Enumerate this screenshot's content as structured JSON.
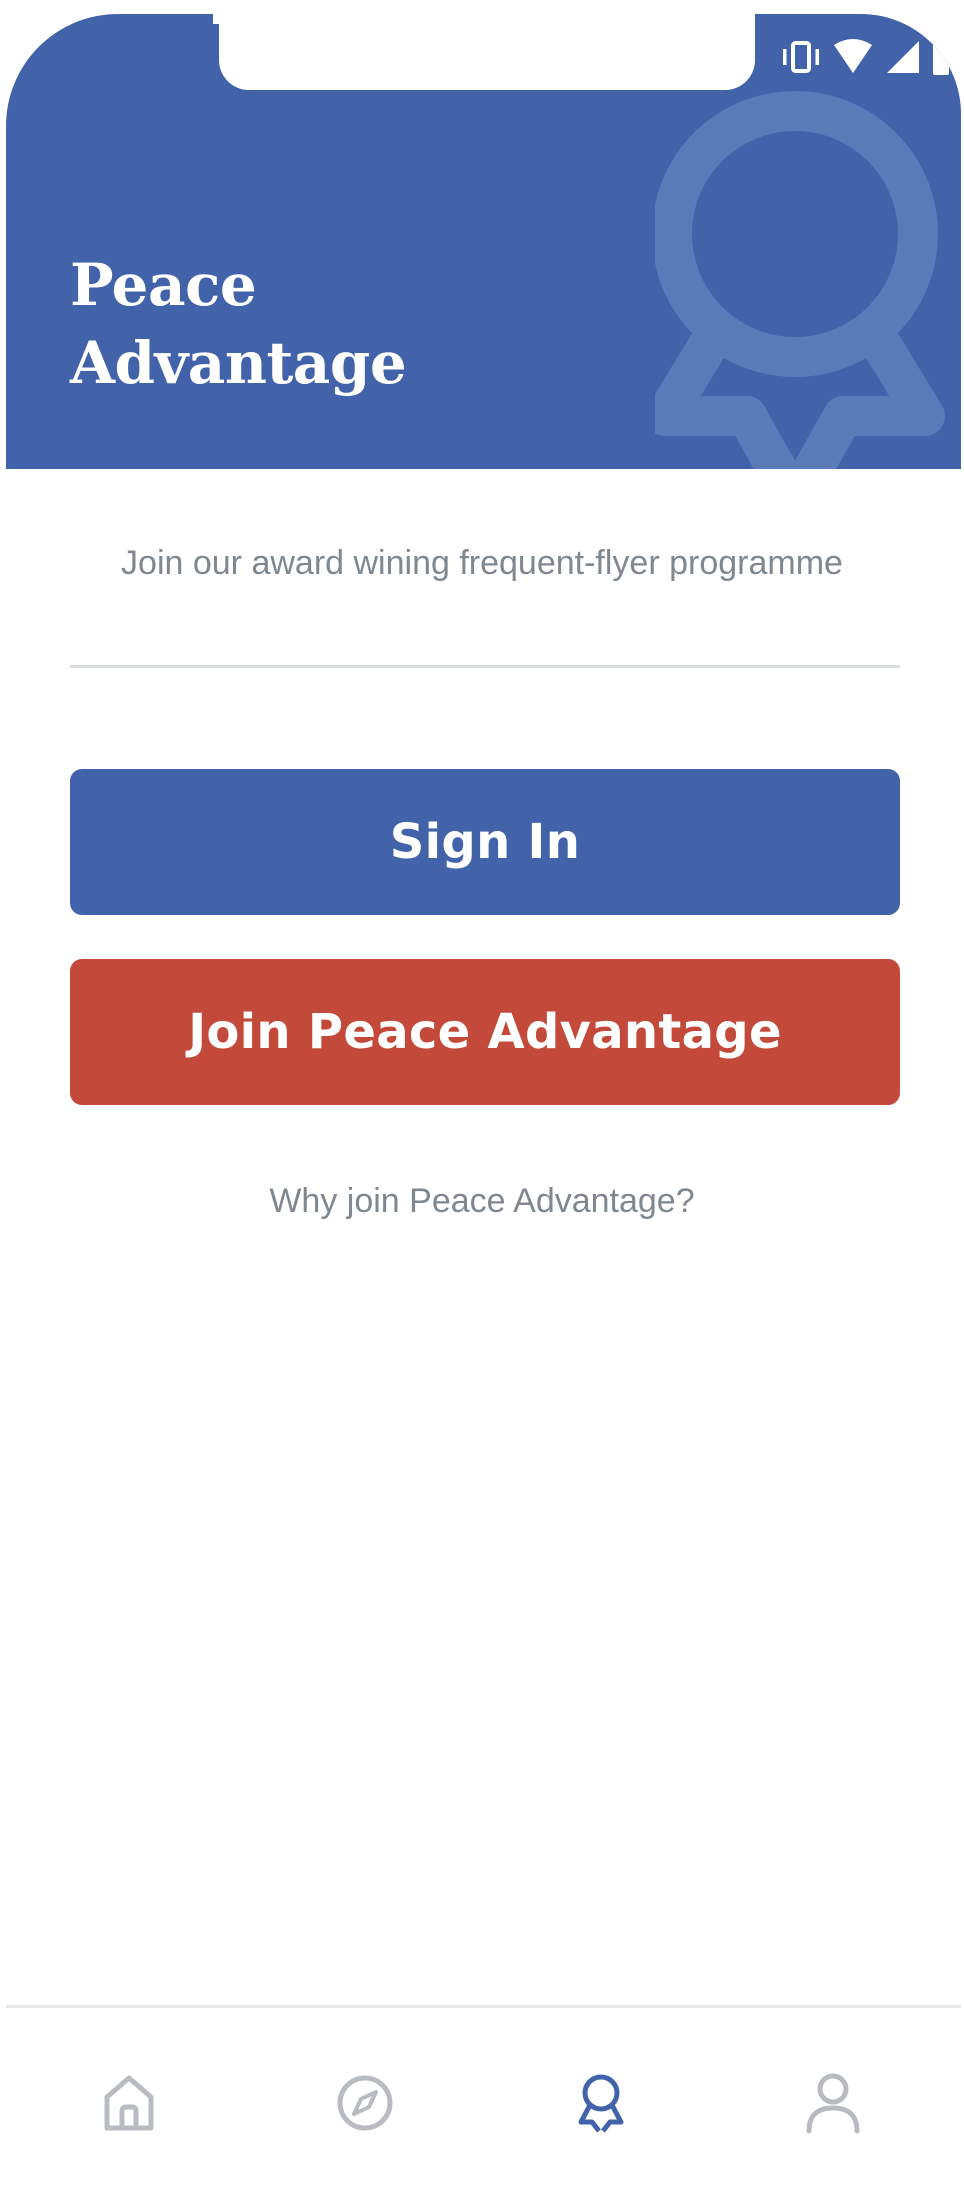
{
  "header": {
    "title_line1": "Peace",
    "title_line2": "Advantage",
    "background_color": "#4263aa"
  },
  "status_bar": {
    "icons": [
      "vibrate-icon",
      "wifi-icon",
      "cellular-signal-icon",
      "battery-icon"
    ]
  },
  "main": {
    "tagline": "Join our award wining frequent-flyer programme",
    "sign_in_label": "Sign In",
    "join_label": "Join Peace Advantage",
    "why_join_link": "Why join Peace Advantage?"
  },
  "colors": {
    "primary": "#4263aa",
    "accent": "#c34a3b",
    "muted_text": "#7f8891"
  },
  "bottom_nav": {
    "items": [
      {
        "icon": "home-icon",
        "active": false
      },
      {
        "icon": "compass-icon",
        "active": false
      },
      {
        "icon": "award-ribbon-icon",
        "active": true
      },
      {
        "icon": "user-icon",
        "active": false
      }
    ]
  }
}
